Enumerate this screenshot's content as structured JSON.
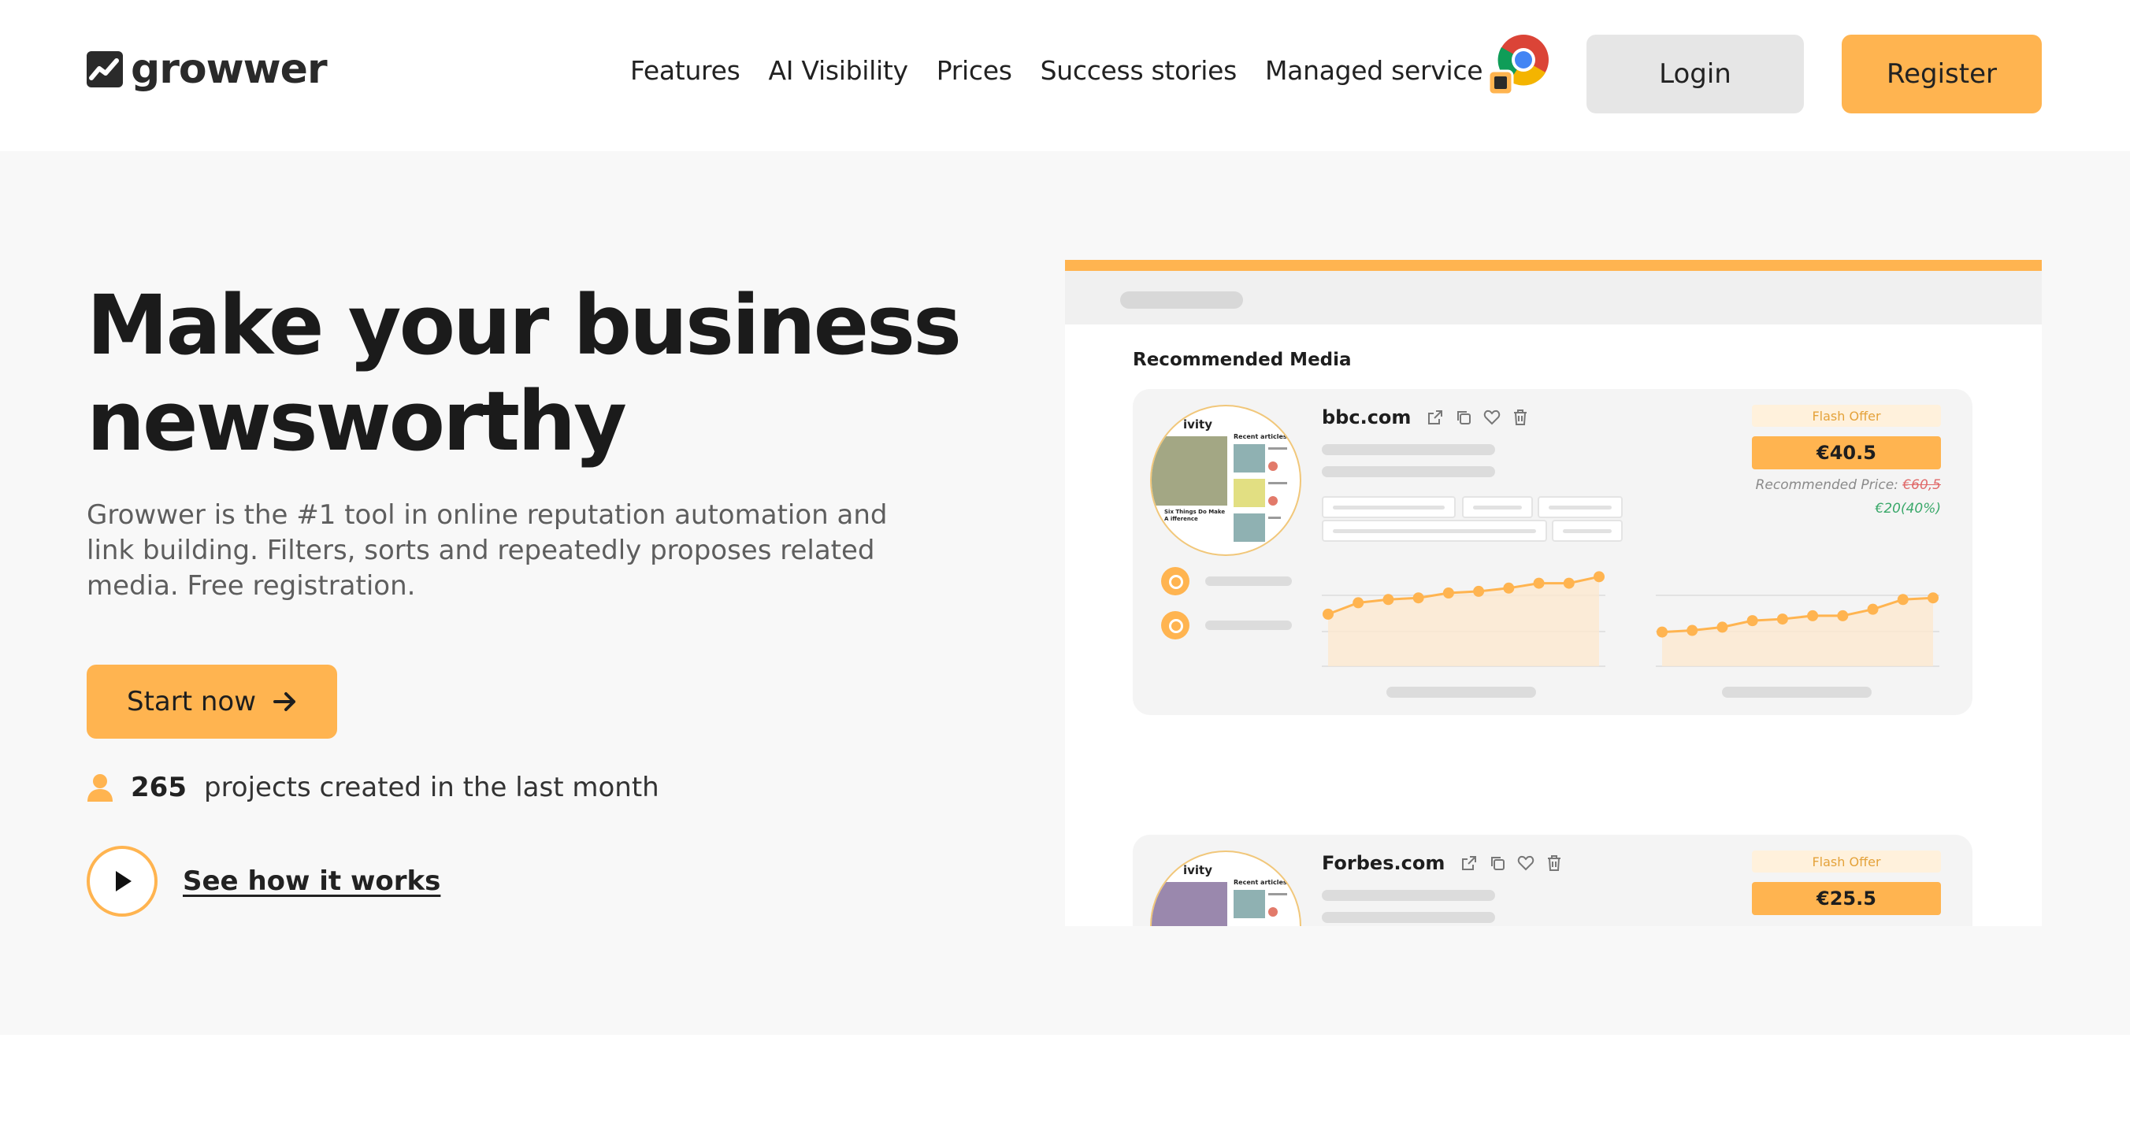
{
  "brand": {
    "name": "growwer"
  },
  "nav": {
    "items": [
      "Features",
      "AI Visibility",
      "Prices",
      "Success stories",
      "Managed service"
    ],
    "extension_icon": "chrome-extension-icon"
  },
  "auth": {
    "login_label": "Login",
    "register_label": "Register"
  },
  "hero": {
    "title": "Make your business newsworthy",
    "description": "Growwer is the #1 tool in online reputation automation and link building. Filters, sorts and repeatedly proposes related media. Free registration.",
    "cta_label": "Start now",
    "projects_count": "265",
    "projects_text": "projects created in the last month",
    "how_label": "See how it works"
  },
  "mockup": {
    "heading": "Recommended Media",
    "cards": [
      {
        "domain": "bbc.com",
        "flash_label": "Flash Offer",
        "price": "€40.5",
        "recommended_prefix": "Recommended Price:",
        "recommended_old": "€60,5",
        "discount": "€20(40%)",
        "thumb_title": "ivity",
        "thumb_recent": "Recent articles",
        "thumb_caption": "Six Things Do Make A ifference",
        "chart_left": [
          3.2,
          3.9,
          4.1,
          4.2,
          4.5,
          4.6,
          4.8,
          5.1,
          5.1,
          5.5
        ],
        "chart_right": [
          2.1,
          2.2,
          2.4,
          2.8,
          2.9,
          3.1,
          3.1,
          3.5,
          4.1,
          4.2
        ]
      },
      {
        "domain": "Forbes.com",
        "flash_label": "Flash Offer",
        "price": "€25.5",
        "thumb_title": "ivity",
        "thumb_recent": "Recent articles"
      }
    ]
  },
  "colors": {
    "accent": "#ffb450",
    "hero_bg": "#f8f8f8",
    "login_bg": "#e6e6e6",
    "discount": "#3aa86a",
    "old_price": "#e06a6a"
  }
}
